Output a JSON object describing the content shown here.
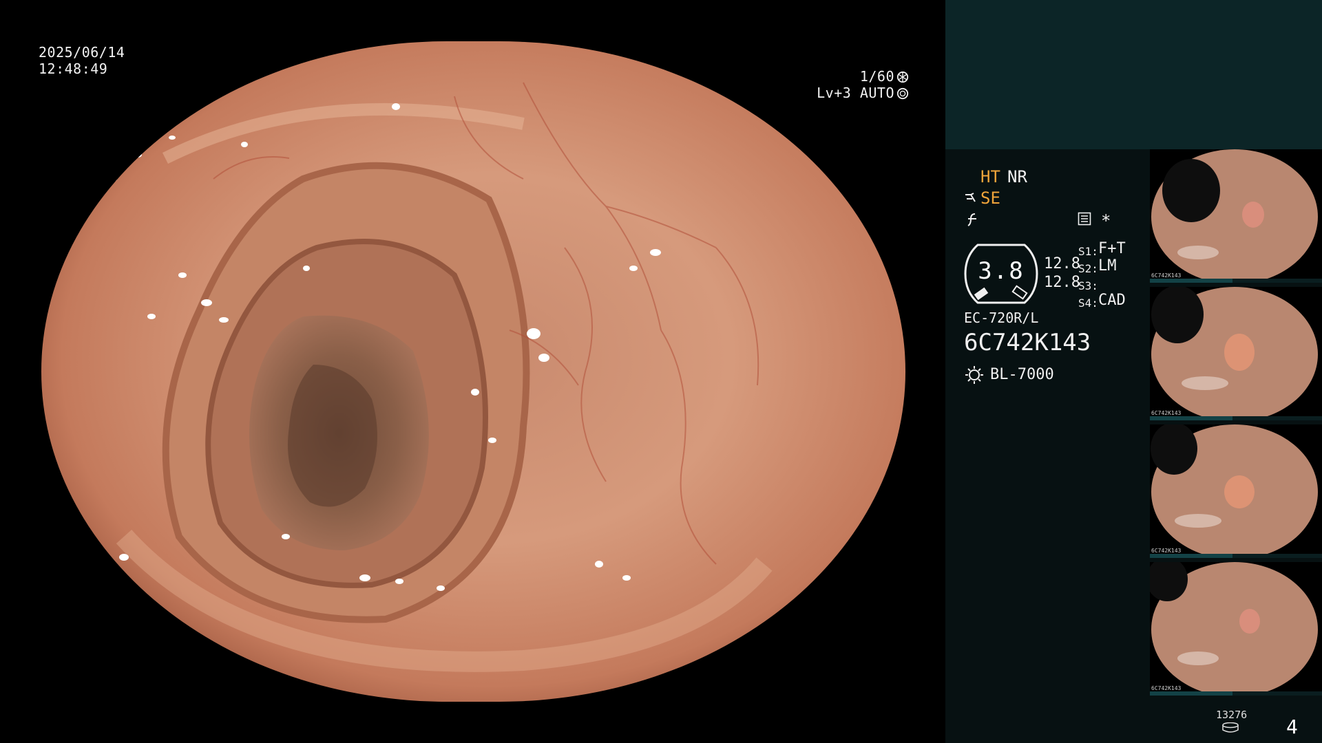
{
  "overlay": {
    "date": "2025/06/14",
    "time": "12:48:49",
    "shutter": "1/60",
    "level": "Lv+3 AUTO"
  },
  "panel": {
    "mode_ht": "HT",
    "mode_nr": "NR",
    "mode_se": "SE",
    "zoom_value": "3.8",
    "value_top": "12.8",
    "value_bottom": "12.8",
    "s1_label": "S1:",
    "s1_value": "F+T",
    "s2_label": "S2:",
    "s2_value": "LM",
    "s3_label": "S3:",
    "s3_value": "",
    "s4_label": "S4:",
    "s4_value": "CAD",
    "asterisk": "*",
    "scope_model": "EC-720R/L",
    "scope_serial": "6C742K143",
    "light_source": "BL-7000",
    "storage_count": "13276",
    "page_number": "4"
  },
  "thumbnails": [
    {
      "caption": "6C742K143"
    },
    {
      "caption": "6C742K143"
    },
    {
      "caption": "6C742K143"
    },
    {
      "caption": "6C742K143"
    }
  ],
  "colors": {
    "mode_accent": "#f0a43a",
    "panel_top": "#0c2527",
    "panel_bg": "#071112"
  },
  "icons": [
    "shutter-wheel-icon",
    "auto-iris-icon",
    "scope-tip-icon",
    "freeze-icon",
    "settings-list-icon",
    "light-bulb-icon",
    "disk-icon"
  ]
}
